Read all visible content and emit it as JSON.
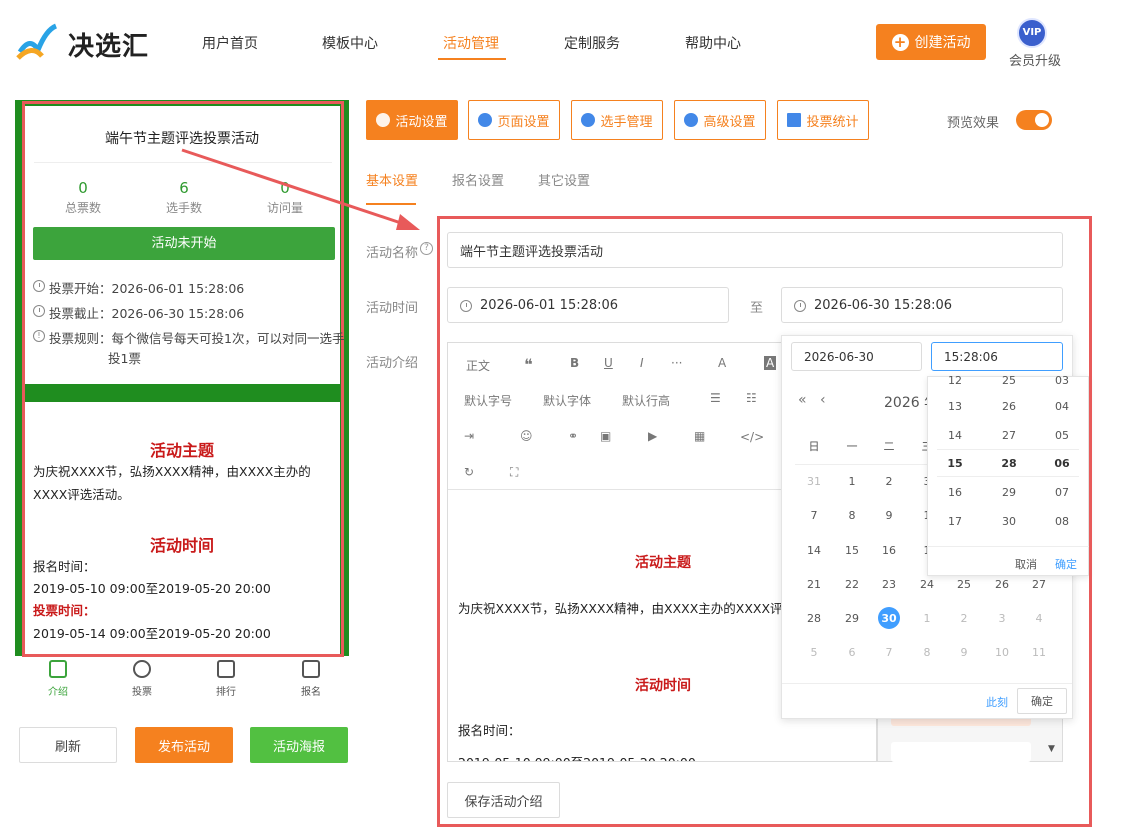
{
  "header": {
    "logo_text": "决选汇",
    "nav": [
      "用户首页",
      "模板中心",
      "活动管理",
      "定制服务",
      "帮助中心"
    ],
    "create_label": "创建活动",
    "vip_badge": "VIP",
    "vip_label": "会员升级"
  },
  "preview": {
    "title": "端午节主题评选投票活动",
    "stats": [
      {
        "value": "0",
        "label": "总票数"
      },
      {
        "value": "6",
        "label": "选手数"
      },
      {
        "value": "0",
        "label": "访问量"
      }
    ],
    "status_button": "活动未开始",
    "vote_start": "投票开始：2026-06-01 15:28:06",
    "vote_end": "投票截止：2026-06-30 15:28:06",
    "vote_rule_1": "投票规则：每个微信号每天可投1次，可以对同一选手",
    "vote_rule_2": "投1票",
    "section1_title": "活动主题",
    "section1_text": "为庆祝XXXX节，弘扬XXXX精神，由XXXX主办的XXXX评选活动。",
    "section2_title": "活动时间",
    "signup_label": "报名时间：",
    "signup_time": "2019-05-10 09:00至2019-05-20 20:00",
    "vote_label": "投票时间：",
    "vote_time": "2019-05-14 09:00至2019-05-20 20:00",
    "tabs": [
      "介绍",
      "投票",
      "排行",
      "报名"
    ]
  },
  "actions": {
    "refresh": "刷新",
    "publish": "发布活动",
    "poster": "活动海报"
  },
  "toolbar": {
    "buttons": [
      "活动设置",
      "页面设置",
      "选手管理",
      "高级设置",
      "投票统计"
    ],
    "preview_label": "预览效果"
  },
  "subtabs": [
    "基本设置",
    "报名设置",
    "其它设置"
  ],
  "form": {
    "name_label": "活动名称",
    "name_value": "端午节主题评选投票活动",
    "time_label": "活动时间",
    "start": "2026-06-01 15:28:06",
    "to": "至",
    "end": "2026-06-30 15:28:06",
    "intro_label": "活动介绍",
    "save_label": "保存活动介绍"
  },
  "editor": {
    "toolbar_row1": [
      "正文",
      "❝",
      "B",
      "U",
      "I",
      "···",
      "A",
      "A"
    ],
    "toolbar_row2": [
      "默认字号",
      "默认字体",
      "默认行高"
    ],
    "section1_title": "活动主题",
    "section1_text": "为庆祝XXXX节，弘扬XXXX精神，由XXXX主办的XXXX评",
    "section2_title": "活动时间",
    "signup_label": "报名时间：",
    "signup_time": "2019-05-10 09:00至2019-05-20 20:00"
  },
  "calendar": {
    "date_value": "2026-06-30",
    "time_value": "15:28:06",
    "month_label": "2026 年",
    "weekdays": [
      "日",
      "一",
      "二",
      "三"
    ],
    "rows": [
      [
        "31",
        "1",
        "2",
        "3"
      ],
      [
        "7",
        "8",
        "9",
        "1"
      ],
      [
        "14",
        "15",
        "16",
        "1"
      ],
      [
        "21",
        "22",
        "23",
        "24",
        "25",
        "26",
        "27"
      ],
      [
        "28",
        "29",
        "30",
        "1",
        "2",
        "3",
        "4"
      ],
      [
        "5",
        "6",
        "7",
        "8",
        "9",
        "10",
        "11"
      ]
    ],
    "now_label": "此刻",
    "ok_label": "确定",
    "time_cols": {
      "h": [
        "12",
        "13",
        "14",
        "15",
        "16",
        "17"
      ],
      "m": [
        "25",
        "26",
        "27",
        "28",
        "29",
        "30"
      ],
      "s": [
        "03",
        "04",
        "05",
        "06",
        "07",
        "08"
      ]
    },
    "cancel_label": "取消",
    "time_ok_label": "确定"
  }
}
